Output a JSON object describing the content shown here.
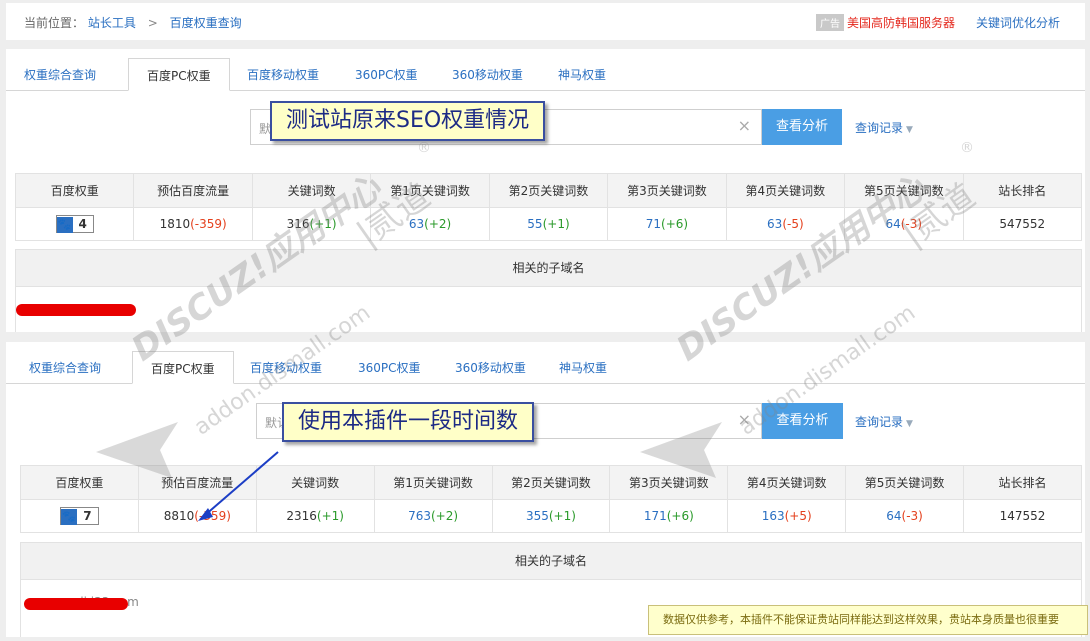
{
  "header": {
    "crumb_prefix": "当前位置：",
    "crumb_1": "站长工具",
    "crumb_sep": ">",
    "crumb_2": "百度权重查询",
    "ad_badge": "广告",
    "ad_text": "美国高防韩国服务器",
    "keyword_link": "关键词优化分析"
  },
  "tabs": [
    "权重综合查询",
    "百度PC权重",
    "百度移动权重",
    "360PC权重",
    "360移动权重",
    "神马权重"
  ],
  "search": {
    "placeholder_1": "默",
    "placeholder_2": "默认",
    "clear": "×",
    "button": "查看分析",
    "history": "查询记录"
  },
  "table_headers": [
    "百度权重",
    "预估百度流量",
    "关键词数",
    "第1页关键词数",
    "第2页关键词数",
    "第3页关键词数",
    "第4页关键词数",
    "第5页关键词数",
    "站长排名"
  ],
  "panel1": {
    "weight": "4",
    "traffic": "1810",
    "traffic_delta": "(-359)",
    "keywords": "316",
    "keywords_delta": "(+1)",
    "p1": "63",
    "p1_delta": "(+2)",
    "p2": "55",
    "p2_delta": "(+1)",
    "p3": "71",
    "p3_delta": "(+6)",
    "p4": "63",
    "p4_delta": "(-5)",
    "p5": "64",
    "p5_delta": "(-3)",
    "rank": "547552"
  },
  "panel2": {
    "weight": "7",
    "traffic": "8810",
    "traffic_delta": "(-359)",
    "keywords": "2316",
    "keywords_delta": "(+1)",
    "p1": "763",
    "p1_delta": "(+2)",
    "p2": "355",
    "p2_delta": "(+1)",
    "p3": "171",
    "p3_delta": "(+6)",
    "p4": "163",
    "p4_delta": "(+5)",
    "p5": "64",
    "p5_delta": "(-3)",
    "rank": "147552"
  },
  "subdomain_title": "相关的子域名",
  "subdomain_ghost": "di   i33.com",
  "callout_1": "测试站原来SEO权重情况",
  "callout_2": "使用本插件一段时间数",
  "notice": "数据仅供参考，本插件不能保证贵站同样能达到这样效果，贵站本身质量也很重要",
  "watermark": {
    "brand": "DISCUZ!应用中心",
    "domain": "addon.dismall.com",
    "name": "|贰道",
    "reg": "®"
  },
  "colors": {
    "link_blue": "#2a6fc1",
    "up_green": "#2a9a2a",
    "down_red": "#e4401d",
    "button_blue": "#4a9ee4",
    "redaction": "#e80000"
  }
}
